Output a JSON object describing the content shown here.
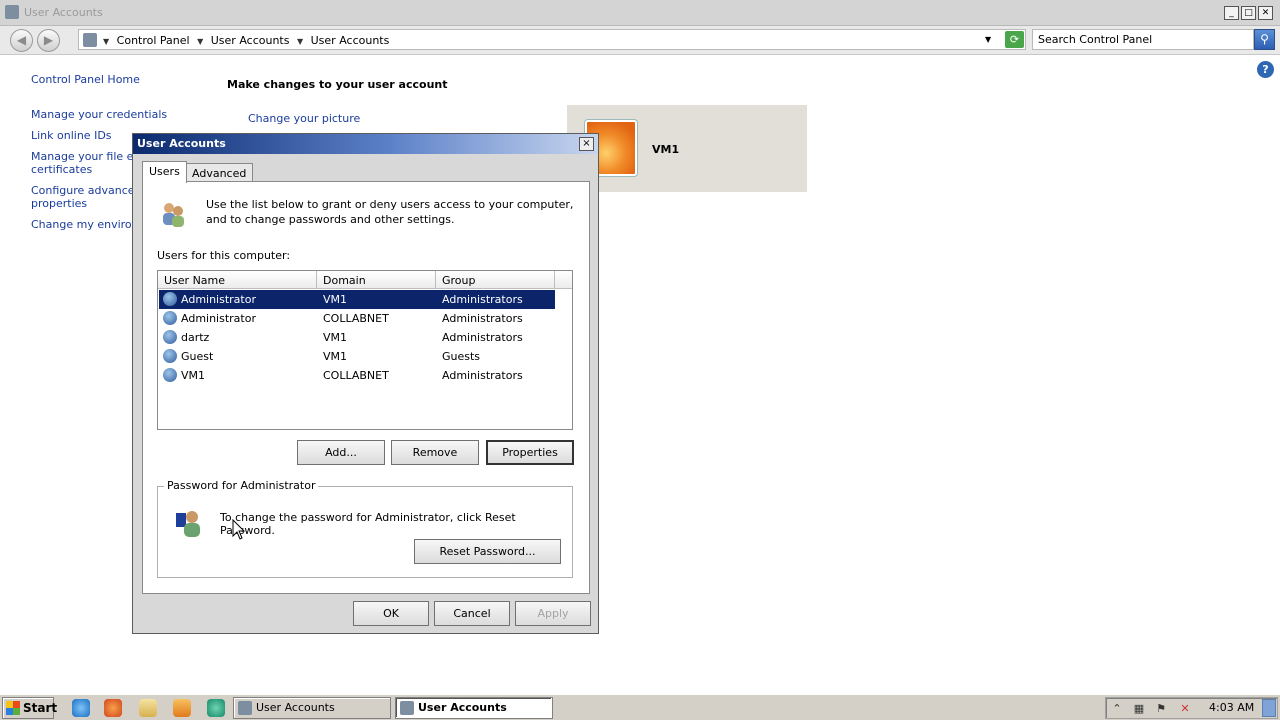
{
  "window": {
    "title": "User Accounts"
  },
  "address": {
    "crumbs": [
      "Control Panel",
      "User Accounts",
      "User Accounts"
    ],
    "search_placeholder": "Search Control Panel"
  },
  "left_nav": {
    "home": "Control Panel Home",
    "links": [
      "Manage your credentials",
      "Link online IDs",
      "Manage your file enc",
      "certificates",
      "Configure advanced",
      "properties",
      "Change my environm"
    ]
  },
  "main": {
    "heading": "Make changes to your user account",
    "change_picture": "Change your picture",
    "user_name": "VM1"
  },
  "dialog": {
    "title": "User Accounts",
    "close": "×",
    "tabs": [
      "Users",
      "Advanced"
    ],
    "intro_line1": "Use the list below to grant or deny users access to your computer,",
    "intro_line2": "and to change passwords and other settings.",
    "users_label": "Users for this computer:",
    "columns": [
      "User Name",
      "Domain",
      "Group"
    ],
    "rows": [
      {
        "name": "Administrator",
        "domain": "VM1",
        "group": "Administrators"
      },
      {
        "name": "Administrator",
        "domain": "COLLABNET",
        "group": "Administrators"
      },
      {
        "name": "dartz",
        "domain": "VM1",
        "group": "Administrators"
      },
      {
        "name": "Guest",
        "domain": "VM1",
        "group": "Guests"
      },
      {
        "name": "VM1",
        "domain": "COLLABNET",
        "group": "Administrators"
      }
    ],
    "buttons": {
      "add": "Add...",
      "remove": "Remove",
      "properties": "Properties"
    },
    "password_group": "Password for Administrator",
    "password_text": "To change the password for Administrator, click Reset Password.",
    "reset": "Reset Password...",
    "ok": "OK",
    "cancel": "Cancel",
    "apply": "Apply"
  },
  "taskbar": {
    "start": "Start",
    "tasks": [
      "User Accounts",
      "User Accounts"
    ],
    "clock": "4:03 AM"
  }
}
